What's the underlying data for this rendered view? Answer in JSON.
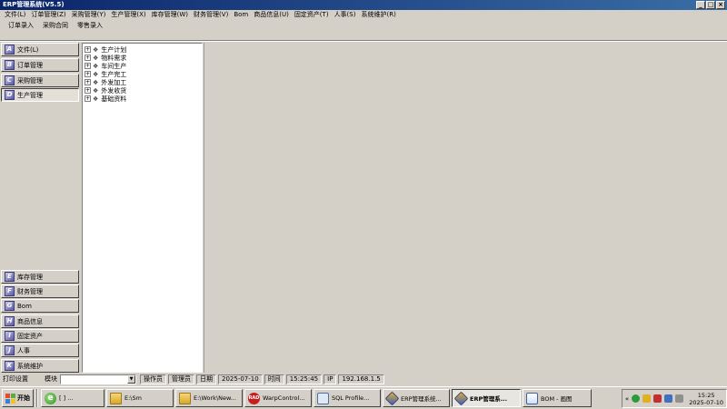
{
  "window": {
    "title": "ERP管理系统(V5.5)"
  },
  "menu": [
    "文件(L)",
    "订单管理(Z)",
    "采购管理(Y)",
    "生产管理(X)",
    "库存管理(W)",
    "财务管理(V)",
    "Bom",
    "商品信息(U)",
    "固定资产(T)",
    "人事(S)",
    "系统维护(R)"
  ],
  "toolbar": [
    "订单录入",
    "采购合同",
    "零售录入"
  ],
  "nav_top": [
    {
      "label": "文件(L)",
      "letter": "A"
    },
    {
      "label": "订单管理",
      "letter": "B"
    },
    {
      "label": "采购管理",
      "letter": "C"
    },
    {
      "label": "生产管理",
      "letter": "D"
    }
  ],
  "nav_bottom": [
    {
      "label": "库存管理",
      "letter": "E"
    },
    {
      "label": "财务管理",
      "letter": "F"
    },
    {
      "label": "Bom",
      "letter": "G"
    },
    {
      "label": "商品信息",
      "letter": "H"
    },
    {
      "label": "固定资产",
      "letter": "I"
    },
    {
      "label": "人事",
      "letter": "J"
    },
    {
      "label": "系统维护",
      "letter": "K"
    }
  ],
  "tree": [
    "生产计划",
    "物料需求",
    "车间生产",
    "生产完工",
    "外发加工",
    "外发收货",
    "基础资料"
  ],
  "status": {
    "print_settings": "打印设置",
    "module_label": "模块",
    "module_value": "",
    "operator_label": "操作员",
    "operator_value": "管理员",
    "date_label": "日期",
    "date_value": "2025-07-10",
    "time_label": "时间",
    "time_value": "15:25:45",
    "ip_label": "IP",
    "ip_value": "192.168.1.5"
  },
  "taskbar": {
    "start": "开始",
    "tasks": [
      {
        "label": "[  ] ...",
        "icon": "ie-icon"
      },
      {
        "label": "E:\\Sm",
        "icon": "folder-icon"
      },
      {
        "label": "E:\\Work\\New...",
        "icon": "folder-icon"
      },
      {
        "label": "WarpControl...",
        "icon": "rad-icon",
        "icon_text": "RAD"
      },
      {
        "label": "SQL Profile...",
        "icon": "sql-icon"
      },
      {
        "label": "ERP管理系统...",
        "icon": "erp-icon"
      },
      {
        "label": "ERP管理系...",
        "icon": "erp-icon",
        "active": true
      },
      {
        "label": "BOM - 画图",
        "icon": "paint-icon"
      }
    ],
    "clock_time": "15:25",
    "clock_date": "2025-07-10"
  }
}
